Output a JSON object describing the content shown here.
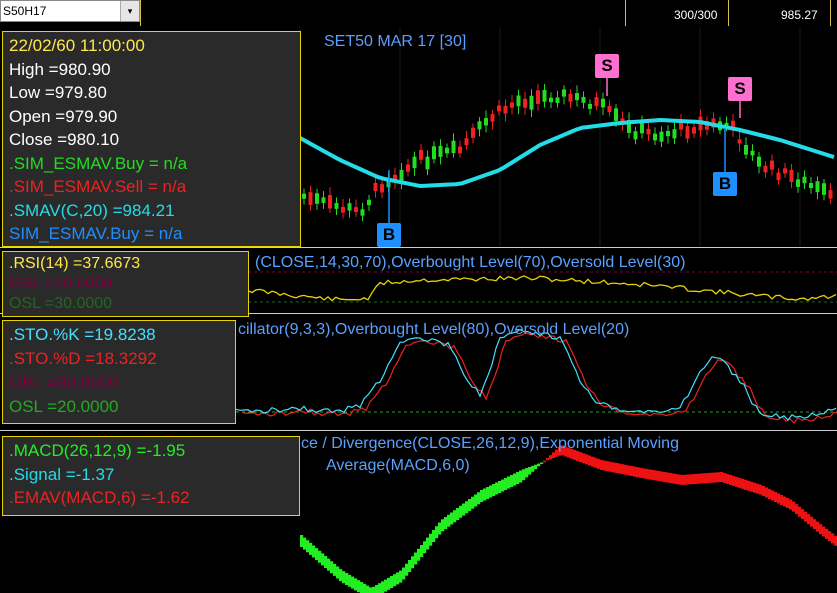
{
  "toolbar": {
    "symbol": "S50H17",
    "dropdown_glyph": "▾",
    "bars": "300/300",
    "last_price": "985.27"
  },
  "price_panel": {
    "title": "SET50 MAR 17   [30]",
    "info": {
      "datetime": "22/02/60 11:00:00",
      "high": "High  =980.90",
      "low": "Low  =979.80",
      "open": "Open  =979.90",
      "close": "Close  =980.10",
      "sim_buy": ".SIM_ESMAV.Buy    = n/a",
      "sim_sell": ".SIM_ESMAV.Sell    = n/a",
      "smav": ".SMAV(C,20)    =984.21",
      "sim_buy2": "SIM_ESMAV.Buy    = n/a"
    },
    "signals": {
      "s1": "S",
      "s2": "S",
      "b1": "B",
      "b2": "B"
    }
  },
  "rsi_panel": {
    "title": "(CLOSE,14,30,70),Overbought Level(70),Oversold Level(30)",
    "info": {
      "rsi": ".RSI(14)    =37.6673",
      "obl": "OBL    =70.0000",
      "osl": "OSL    =30.0000"
    }
  },
  "sto_panel": {
    "title": "cillator(9,3,3),Overbought Level(80),Oversold Level(20)",
    "info": {
      "k": ".STO.%K    =19.8238",
      "d": ".STO.%D    =18.3292",
      "obl": "OBL    =80.0000",
      "osl": "OSL    =20.0000"
    }
  },
  "macd_panel": {
    "title_line1": "ce / Divergence(CLOSE,26,12,9),Exponential Moving",
    "title_line2": "Average(MACD,6,0)",
    "info": {
      "macd": ".MACD(26,12,9)    =-1.95",
      "signal": ".Signal    =-1.37",
      "emav": ".EMAV(MACD,6)    =-1.62"
    }
  },
  "colors": {
    "background": "#000000",
    "up_candle": "#22dd22",
    "down_candle": "#ee2222",
    "smav_line": "#22dde8",
    "rsi_line": "#e6d300",
    "sto_k": "#44e0ff",
    "sto_d": "#ee2222",
    "macd_pos": "#22ee22",
    "macd_neg": "#ee1111",
    "title": "#5aa0ff",
    "box_border": "#e6d300"
  }
}
